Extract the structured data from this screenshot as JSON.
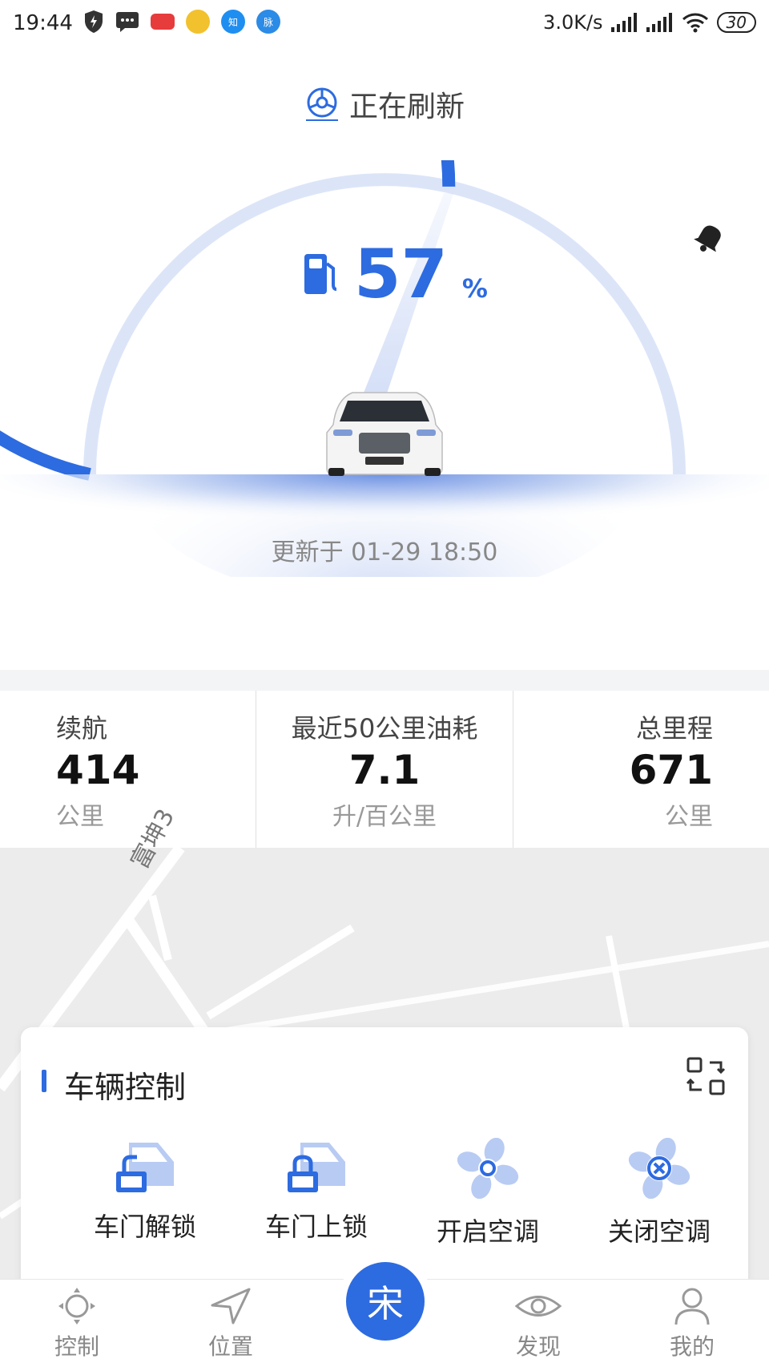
{
  "status_bar": {
    "time": "19:44",
    "network_speed": "3.0K/s",
    "battery": "30"
  },
  "refresh": {
    "label": "正在刷新"
  },
  "gauge": {
    "fuel_percent": 57,
    "fuel_value": "57",
    "fuel_unit": "%",
    "icon": "fuel-pump-icon"
  },
  "updated": {
    "text": "更新于 01-29 18:50"
  },
  "stats": {
    "range": {
      "label": "续航",
      "value": "414",
      "unit": "公里"
    },
    "consumption": {
      "label": "最近50公里油耗",
      "value": "7.1",
      "unit": "升/百公里"
    },
    "odometer": {
      "label": "总里程",
      "value": "671",
      "unit": "公里"
    }
  },
  "map": {
    "road_label": "富坤3"
  },
  "vehicle_control": {
    "title": "车辆控制",
    "items": [
      {
        "label": "车门解锁",
        "icon": "door-unlock-icon"
      },
      {
        "label": "车门上锁",
        "icon": "door-lock-icon"
      },
      {
        "label": "开启空调",
        "icon": "ac-on-icon"
      },
      {
        "label": "关闭空调",
        "icon": "ac-off-icon"
      }
    ]
  },
  "tabs": {
    "control": "控制",
    "location": "位置",
    "center": "宋",
    "discover": "发现",
    "mine": "我的"
  },
  "colors": {
    "accent": "#2d6be0",
    "accent_light": "#dbe5fa"
  }
}
